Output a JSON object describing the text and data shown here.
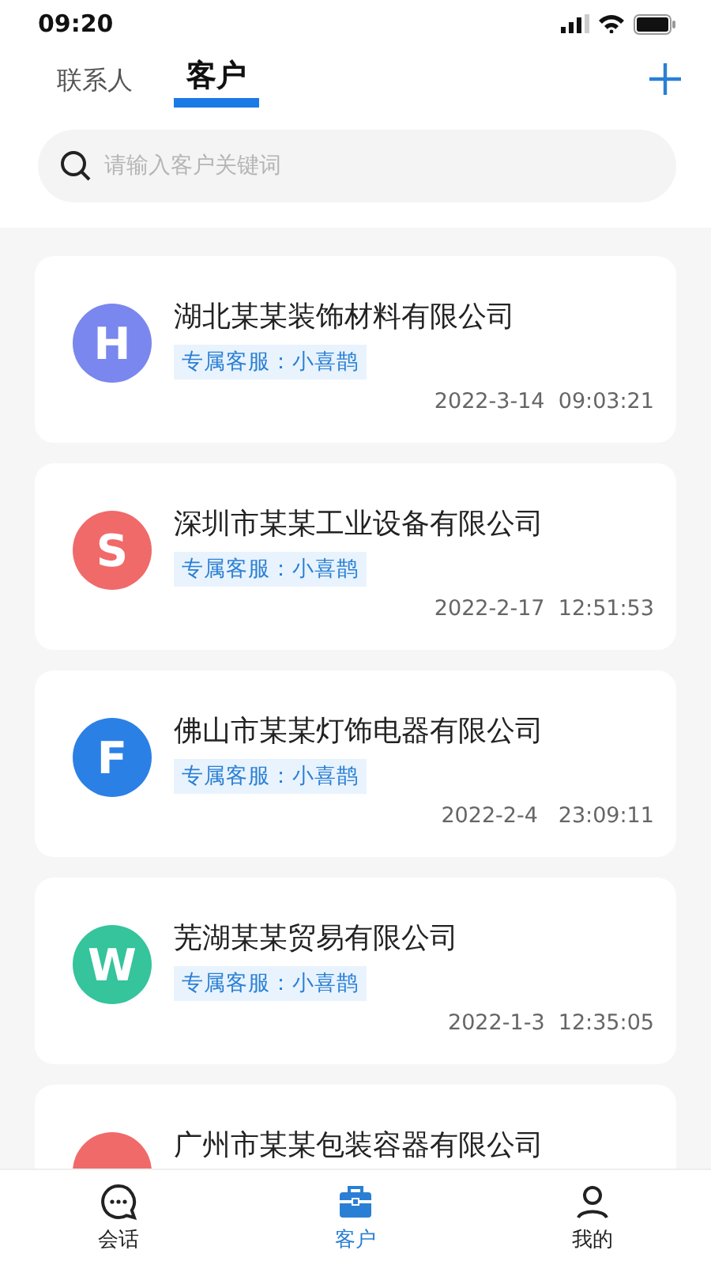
{
  "status_bar": {
    "time": "09:20"
  },
  "tabs": [
    {
      "label": "联系人",
      "selected": false
    },
    {
      "label": "客户",
      "selected": true
    }
  ],
  "search": {
    "placeholder": "请输入客户关键词"
  },
  "customers": [
    {
      "initial": "H",
      "color": "#7a87ee",
      "name": "湖北某某装饰材料有限公司",
      "tag": "专属客服：小喜鹊",
      "time": "2022-3-14  09:03:21"
    },
    {
      "initial": "S",
      "color": "#f06a6a",
      "name": "深圳市某某工业设备有限公司",
      "tag": "专属客服：小喜鹊",
      "time": "2022-2-17  12:51:53"
    },
    {
      "initial": "F",
      "color": "#2b80e6",
      "name": "佛山市某某灯饰电器有限公司",
      "tag": "专属客服：小喜鹊",
      "time": "2022-2-4   23:09:11"
    },
    {
      "initial": "W",
      "color": "#35c49c",
      "name": "芜湖某某贸易有限公司",
      "tag": "专属客服：小喜鹊",
      "time": "2022-1-3  12:35:05"
    },
    {
      "color": "#f06a6a",
      "name": "广州市某某包装容器有限公司"
    }
  ],
  "bottom_nav": [
    {
      "label": "会话",
      "kind": "chat",
      "selected": false
    },
    {
      "label": "客户",
      "kind": "case",
      "selected": true
    },
    {
      "label": "我的",
      "kind": "person",
      "selected": false
    }
  ]
}
